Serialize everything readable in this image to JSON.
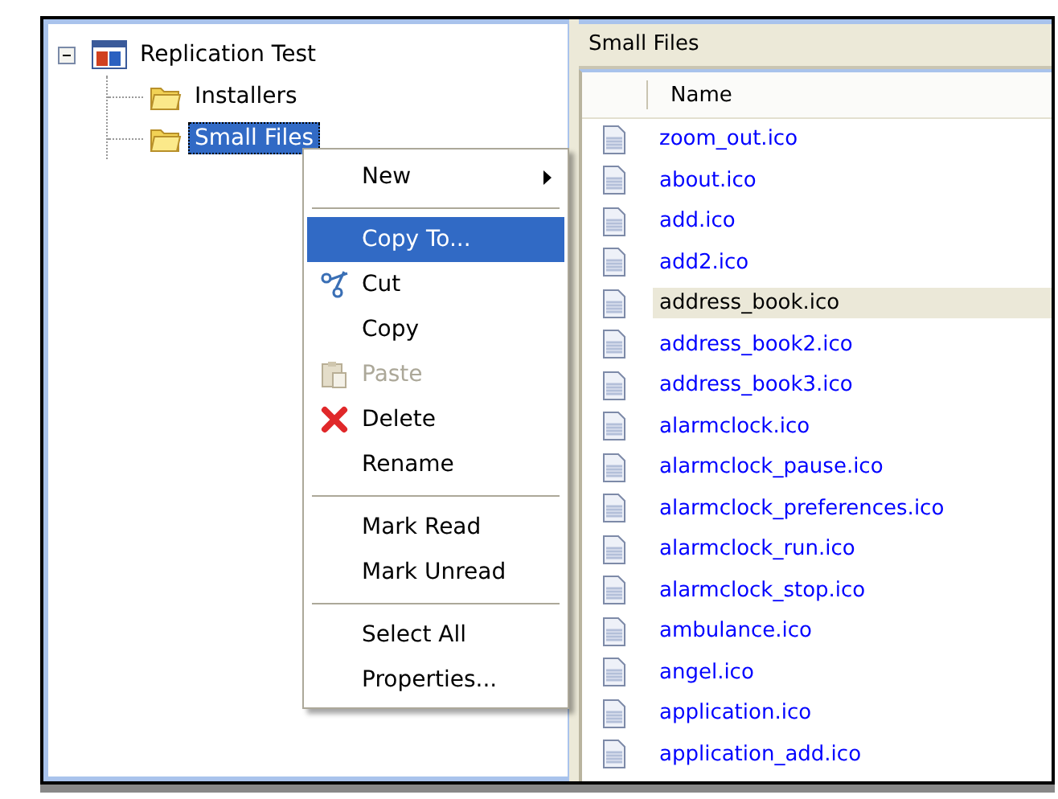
{
  "tree": [
    {
      "label": "Replication Test",
      "kind": "replica",
      "expanded": true,
      "selected": false,
      "children": [
        {
          "label": "Installers",
          "kind": "folder",
          "selected": false
        },
        {
          "label": "Small Files",
          "kind": "folder",
          "selected": true
        }
      ]
    }
  ],
  "context_menu": [
    {
      "kind": "submenu",
      "label": "New",
      "selected": false,
      "disabled": false
    },
    {
      "kind": "separator"
    },
    {
      "kind": "item",
      "label": "Copy To...",
      "selected": true,
      "disabled": false
    },
    {
      "kind": "scissors",
      "label": "Cut",
      "selected": false,
      "disabled": false
    },
    {
      "kind": "item",
      "label": "Copy",
      "selected": false,
      "disabled": false
    },
    {
      "kind": "clipboard",
      "label": "Paste",
      "selected": false,
      "disabled": true
    },
    {
      "kind": "cross",
      "label": "Delete",
      "selected": false,
      "disabled": false
    },
    {
      "kind": "item",
      "label": "Rename",
      "selected": false,
      "disabled": false
    },
    {
      "kind": "separator"
    },
    {
      "kind": "item",
      "label": "Mark Read",
      "selected": false,
      "disabled": false
    },
    {
      "kind": "item",
      "label": "Mark Unread",
      "selected": false,
      "disabled": false
    },
    {
      "kind": "separator"
    },
    {
      "kind": "item",
      "label": "Select All",
      "selected": false,
      "disabled": false
    },
    {
      "kind": "item",
      "label": "Properties...",
      "selected": false,
      "disabled": false
    }
  ],
  "file_pane": {
    "title": "Small Files",
    "columns": [
      "Name"
    ],
    "rows": [
      {
        "name": "zoom_out.ico",
        "selected": false
      },
      {
        "name": "about.ico",
        "selected": false
      },
      {
        "name": "add.ico",
        "selected": false
      },
      {
        "name": "add2.ico",
        "selected": false
      },
      {
        "name": "address_book.ico",
        "selected": true
      },
      {
        "name": "address_book2.ico",
        "selected": false
      },
      {
        "name": "address_book3.ico",
        "selected": false
      },
      {
        "name": "alarmclock.ico",
        "selected": false
      },
      {
        "name": "alarmclock_pause.ico",
        "selected": false
      },
      {
        "name": "alarmclock_preferences.ico",
        "selected": false
      },
      {
        "name": "alarmclock_run.ico",
        "selected": false
      },
      {
        "name": "alarmclock_stop.ico",
        "selected": false
      },
      {
        "name": "ambulance.ico",
        "selected": false
      },
      {
        "name": "angel.ico",
        "selected": false
      },
      {
        "name": "application.ico",
        "selected": false
      },
      {
        "name": "application_add.ico",
        "selected": false
      }
    ]
  }
}
